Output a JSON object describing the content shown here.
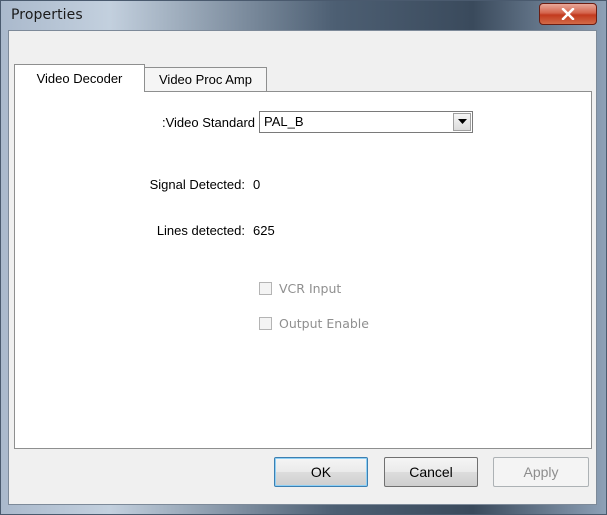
{
  "window": {
    "title": "Properties"
  },
  "tabs": [
    {
      "label": "Video Decoder",
      "active": true
    },
    {
      "label": "Video Proc Amp",
      "active": false
    }
  ],
  "video_standard": {
    "label": ":Video Standard",
    "value": "PAL_B"
  },
  "signal_detected": {
    "label": "Signal Detected:",
    "value": "0"
  },
  "lines_detected": {
    "label": "Lines detected:",
    "value": "625"
  },
  "checkboxes": [
    {
      "label": "VCR Input",
      "checked": false,
      "enabled": false
    },
    {
      "label": "Output Enable",
      "checked": false,
      "enabled": false
    }
  ],
  "buttons": {
    "ok": "OK",
    "cancel": "Cancel",
    "apply": "Apply"
  },
  "icons": {
    "close": "close-icon",
    "dropdown": "chevron-down-icon"
  },
  "colors": {
    "close_button": "#c9442a",
    "disabled_text": "#8f8f8f",
    "dialog_face": "#f0f0f0"
  }
}
